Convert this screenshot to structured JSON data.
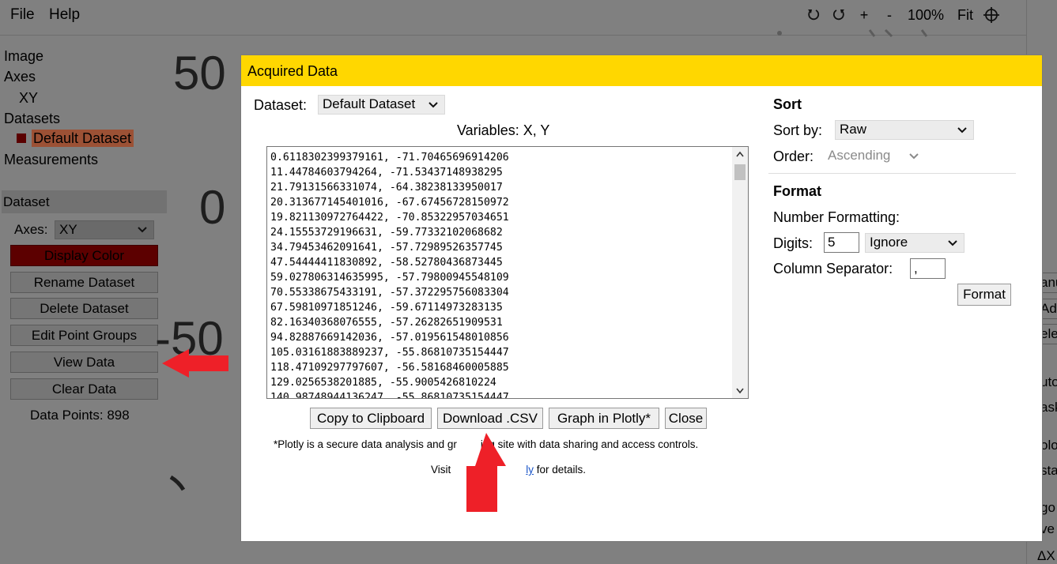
{
  "menu": {
    "file": "File",
    "help": "Help"
  },
  "toolbar": {
    "plus": "+",
    "minus": "-",
    "zoom": "100%",
    "fit": "Fit",
    "icons": [
      "undo-icon",
      "redo-icon",
      "crosshair-icon"
    ]
  },
  "tree": {
    "image": "Image",
    "axes": "Axes",
    "xy": "XY",
    "datasets": "Datasets",
    "default_dataset": "Default Dataset",
    "measurements": "Measurements"
  },
  "dataset_panel": {
    "header": "Dataset",
    "axes_label": "Axes:",
    "axes_value": "XY",
    "display_color": "Display Color",
    "rename": "Rename Dataset",
    "delete": "Delete Dataset",
    "edit_groups": "Edit Point Groups",
    "view_data": "View Data",
    "clear_data": "Clear Data",
    "data_points": "Data Points: 898"
  },
  "plot_ticks": [
    "50",
    "0",
    "-50"
  ],
  "right_fragments": [
    "anu",
    "Ad",
    "ele",
    "uto",
    "ask",
    "olo",
    "sta",
    "go",
    "ve",
    "ΔX"
  ],
  "modal": {
    "title": "Acquired Data",
    "dataset_label": "Dataset:",
    "dataset_value": "Default Dataset",
    "variables": "Variables: X, Y",
    "data_lines": [
      "0.6118302399379161, -71.70465696914206",
      "11.44784603794264, -71.53437148938295",
      "21.79131566331074, -64.38238133950017",
      "20.313677145401016, -67.67456728150972",
      "19.821130972764422, -70.85322957034651",
      "24.15553729196631, -59.77332102068682",
      "34.79453462091641, -57.72989526357745",
      "47.54444411830892, -58.52780436873445",
      "59.027806314635995, -57.79800945548109",
      "70.55338675433191, -57.372295756083304",
      "67.59810971851246, -59.67114973283135",
      "82.16340368076555, -57.26282651909531",
      "94.82887669142036, -57.019561548010856",
      "105.03161883889237, -55.86810735154447",
      "118.47109297797607, -56.58168460005885",
      "129.0256538201885, -55.9005426810224",
      "140.98748944136247, -55.86810735154447"
    ],
    "copy": "Copy to Clipboard",
    "download": "Download .CSV",
    "plotly": "Graph in Plotly*",
    "close": "Close",
    "footnote1_a": "*Plotly is a secure data analysis and gr",
    "footnote1_b": "ing site with data sharing and access controls.",
    "footnote2_a": "Visit",
    "footnote2_link": "ly",
    "footnote2_b": "for details.",
    "sort": {
      "heading": "Sort",
      "sort_by_label": "Sort by:",
      "sort_by_value": "Raw",
      "order_label": "Order:",
      "order_value": "Ascending"
    },
    "format": {
      "heading": "Format",
      "number_formatting": "Number Formatting:",
      "digits_label": "Digits:",
      "digits_value": "5",
      "digits_mode": "Ignore",
      "column_sep_label": "Column Separator:",
      "column_sep_value": ",",
      "format_button": "Format"
    }
  },
  "colors": {
    "title_bar": "#ffd700",
    "arrow": "#ee2028",
    "display_color": "#5c0000"
  }
}
